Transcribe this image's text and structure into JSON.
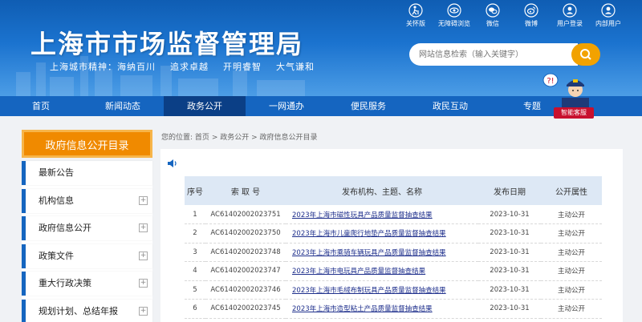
{
  "site": {
    "title": "上海市市场监督管理局",
    "motto": "上海城市精神：海纳百川    追求卓越    开明睿智    大气谦和"
  },
  "top_links": [
    {
      "label": "关怀版",
      "icon": "elder-care-icon"
    },
    {
      "label": "无障碍浏览",
      "icon": "eye-icon"
    },
    {
      "label": "微信",
      "icon": "wechat-icon"
    },
    {
      "label": "微博",
      "icon": "weibo-icon"
    },
    {
      "label": "用户登录",
      "icon": "user-icon"
    },
    {
      "label": "内部用户",
      "icon": "user-icon"
    }
  ],
  "search": {
    "placeholder": "网站信息检索（输入关键字）"
  },
  "nav": [
    {
      "label": "首页"
    },
    {
      "label": "新闻动态"
    },
    {
      "label": "政务公开",
      "active": true
    },
    {
      "label": "一网通办"
    },
    {
      "label": "便民服务"
    },
    {
      "label": "政民互动"
    },
    {
      "label": "专题"
    }
  ],
  "customer_service": {
    "label": "智能客服"
  },
  "sidebar": {
    "title": "政府信息公开目录",
    "items": [
      {
        "label": "最新公告",
        "expandable": false
      },
      {
        "label": "机构信息",
        "expandable": true
      },
      {
        "label": "政府信息公开",
        "expandable": true
      },
      {
        "label": "政策文件",
        "expandable": true
      },
      {
        "label": "重大行政决策",
        "expandable": true
      },
      {
        "label": "规划计划、总结年报",
        "expandable": true
      }
    ]
  },
  "breadcrumb": {
    "prefix": "您的位置:",
    "items": [
      "首页",
      "政务公开",
      "政府信息公开目录"
    ],
    "separator": ">"
  },
  "table": {
    "headers": [
      "序号",
      "索 取 号",
      "发布机构、主题、名称",
      "发布日期",
      "公开属性"
    ],
    "rows": [
      {
        "no": "1",
        "id": "AC6140200202375​1",
        "title": "2023年上海市磁性玩具产品质量监督抽查结果",
        "date": "2023-10-31",
        "attr": "主动公开"
      },
      {
        "no": "2",
        "id": "AC61402002023750",
        "title": "2023年上海市儿童爬行地垫产品质量监督抽查结果",
        "date": "2023-10-31",
        "attr": "主动公开"
      },
      {
        "no": "3",
        "id": "AC61402002023748",
        "title": "2023年上海市乘骑车辆玩具产品质量监督抽查结果",
        "date": "2023-10-31",
        "attr": "主动公开"
      },
      {
        "no": "4",
        "id": "AC61402002023747",
        "title": "2023年上海市电玩具产品质量监督抽查结果",
        "date": "2023-10-31",
        "attr": "主动公开"
      },
      {
        "no": "5",
        "id": "AC61402002023746",
        "title": "2023年上海市毛绒布制玩具产品质量监督抽查结果",
        "date": "2023-10-31",
        "attr": "主动公开"
      },
      {
        "no": "6",
        "id": "AC61402002023745",
        "title": "2023年上海市造型粘土产品质量监督抽查结果",
        "date": "2023-10-31",
        "attr": "主动公开"
      }
    ]
  },
  "colors": {
    "brand_blue": "#1565c0",
    "nav_active": "#0b3f86",
    "accent_orange": "#f08a00",
    "search_button": "#f2a200"
  }
}
